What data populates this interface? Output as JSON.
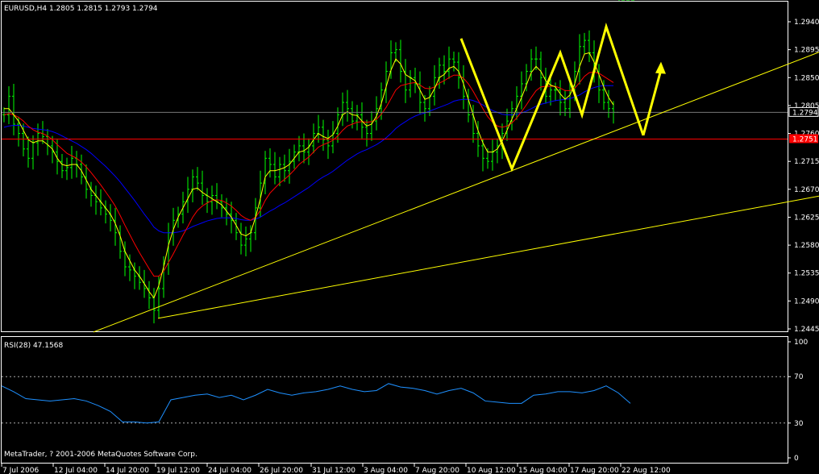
{
  "window": {
    "header_text": "EURUSD,H4  1.2805 1.2815 1.2793 1.2794",
    "copyright": "MetaTrader, ? 2001-2006 MetaQuotes Software Corp."
  },
  "colors": {
    "background": "#000000",
    "frame": "#ffffff",
    "bars": "#00ff00",
    "ma_fast": "#ffff00",
    "ma_medium": "#ff0000",
    "ma_slow": "#0000ff",
    "trendlines": "#ffff00",
    "support_line": "#ff0000",
    "pattern_overlay": "#ffff00",
    "rsi": "#1e90ff",
    "rsi_levels": "#aaaaaa"
  },
  "chart_data": [
    {
      "type": "candlestick",
      "symbol": "EURUSD",
      "timeframe": "H4",
      "ohlc_last": {
        "open": 1.2805,
        "high": 1.2815,
        "low": 1.2793,
        "close": 1.2794
      },
      "price_ticks": [
        "1.2940",
        "1.2895",
        "1.2850",
        "1.2805",
        "1.2760",
        "1.2715",
        "1.2670",
        "1.2625",
        "1.2580",
        "1.2535",
        "1.2490",
        "1.2445"
      ],
      "ylim": [
        1.244,
        1.2965
      ],
      "current_price_label": "1.2794",
      "support_price_label": "1.2751",
      "support_price": 1.2751,
      "time_ticks": [
        "7 Jul 2006",
        "12 Jul 04:00",
        "14 Jul 20:00",
        "19 Jul 12:00",
        "24 Jul 04:00",
        "26 Jul 20:00",
        "31 Jul 12:00",
        "3 Aug 04:00",
        "7 Aug 20:00",
        "10 Aug 12:00",
        "15 Aug 04:00",
        "17 Aug 20:00",
        "22 Aug 12:00"
      ],
      "price_series": {
        "x": [
          0,
          6,
          12,
          18,
          24,
          30,
          36,
          42,
          48,
          54,
          60,
          66,
          72,
          78,
          84,
          90,
          96,
          102,
          108,
          114,
          120,
          126,
          132,
          138,
          144,
          150,
          156,
          162,
          168,
          174,
          180,
          186,
          192,
          198,
          204,
          210,
          216,
          222,
          228,
          234,
          240,
          246,
          252,
          258,
          264,
          270,
          276,
          282,
          288,
          294,
          300,
          306,
          312,
          318,
          324,
          330,
          336,
          342,
          348,
          354,
          360,
          366,
          372,
          378,
          384,
          390,
          396,
          402,
          408,
          414,
          420,
          426,
          432,
          438,
          444,
          450,
          456,
          462,
          468,
          474,
          480,
          486,
          492,
          498,
          504,
          510,
          516,
          522,
          528,
          534,
          540,
          546,
          552,
          558,
          564,
          570,
          576,
          582,
          588,
          594,
          600,
          606,
          612,
          618,
          624,
          630,
          636,
          642,
          648,
          654,
          660,
          666,
          672,
          678,
          684,
          690,
          696,
          702,
          708,
          714,
          720,
          726,
          732,
          738,
          744,
          750,
          756,
          762,
          768,
          774,
          780
        ],
        "close": [
          1.279,
          1.282,
          1.2775,
          1.276,
          1.2735,
          1.272,
          1.2745,
          1.276,
          1.2755,
          1.274,
          1.273,
          1.2715,
          1.27,
          1.2705,
          1.272,
          1.271,
          1.269,
          1.267,
          1.266,
          1.265,
          1.264,
          1.263,
          1.262,
          1.26,
          1.257,
          1.2545,
          1.254,
          1.253,
          1.252,
          1.251,
          1.2495,
          1.2475,
          1.251,
          1.255,
          1.26,
          1.262,
          1.263,
          1.265,
          1.267,
          1.269,
          1.268,
          1.266,
          1.265,
          1.266,
          1.265,
          1.264,
          1.263,
          1.262,
          1.26,
          1.258,
          1.259,
          1.26,
          1.264,
          1.268,
          1.272,
          1.271,
          1.269,
          1.271,
          1.27,
          1.2715,
          1.273,
          1.274,
          1.273,
          1.274,
          1.276,
          1.277,
          1.275,
          1.274,
          1.276,
          1.279,
          1.281,
          1.28,
          1.278,
          1.279,
          1.277,
          1.276,
          1.278,
          1.28,
          1.283,
          1.286,
          1.289,
          1.2895,
          1.286,
          1.283,
          1.285,
          1.284,
          1.281,
          1.28,
          1.282,
          1.285,
          1.287,
          1.286,
          1.288,
          1.2875,
          1.285,
          1.282,
          1.279,
          1.276,
          1.274,
          1.272,
          1.2715,
          1.273,
          1.274,
          1.276,
          1.278,
          1.28,
          1.282,
          1.284,
          1.286,
          1.288,
          1.288,
          1.285,
          1.282,
          1.283,
          1.283,
          1.281,
          1.28,
          1.283,
          1.286,
          1.29,
          1.291,
          1.289,
          1.286,
          1.283,
          1.281,
          1.28,
          1.2794
        ],
        "ma_fast": [
          1.28,
          1.28,
          1.279,
          1.278,
          1.2765,
          1.275,
          1.2745,
          1.2748,
          1.2748,
          1.2742,
          1.2735,
          1.272,
          1.271,
          1.2708,
          1.271,
          1.271,
          1.27,
          1.2685,
          1.267,
          1.266,
          1.265,
          1.264,
          1.263,
          1.2615,
          1.2595,
          1.257,
          1.2555,
          1.254,
          1.253,
          1.2518,
          1.2505,
          1.2495,
          1.2515,
          1.2545,
          1.258,
          1.2605,
          1.2625,
          1.264,
          1.2655,
          1.267,
          1.2672,
          1.2665,
          1.266,
          1.2655,
          1.265,
          1.2645,
          1.2635,
          1.2625,
          1.2612,
          1.2598,
          1.2595,
          1.26,
          1.2625,
          1.2655,
          1.269,
          1.27,
          1.27,
          1.2702,
          1.2705,
          1.271,
          1.272,
          1.273,
          1.2732,
          1.2738,
          1.275,
          1.276,
          1.2755,
          1.2752,
          1.2758,
          1.2772,
          1.279,
          1.2795,
          1.279,
          1.2789,
          1.278,
          1.2772,
          1.2775,
          1.2788,
          1.2808,
          1.2835,
          1.2862,
          1.288,
          1.2872,
          1.2855,
          1.285,
          1.2845,
          1.283,
          1.2815,
          1.2818,
          1.2832,
          1.285,
          1.2855,
          1.2865,
          1.2868,
          1.286,
          1.284,
          1.2815,
          1.279,
          1.2765,
          1.2745,
          1.273,
          1.273,
          1.2735,
          1.2748,
          1.2765,
          1.2783,
          1.28,
          1.2818,
          1.2838,
          1.2858,
          1.2868,
          1.286,
          1.2845,
          1.2838,
          1.2835,
          1.2824,
          1.2815,
          1.2822,
          1.284,
          1.2868,
          1.2888,
          1.289,
          1.2875,
          1.2855,
          1.2835,
          1.2818,
          1.2806
        ],
        "ma_medium": [
          1.279,
          1.2792,
          1.279,
          1.2786,
          1.278,
          1.2772,
          1.2766,
          1.2762,
          1.276,
          1.2756,
          1.275,
          1.2742,
          1.2735,
          1.2728,
          1.2724,
          1.272,
          1.2714,
          1.2706,
          1.2697,
          1.2687,
          1.2677,
          1.2666,
          1.2655,
          1.2643,
          1.2628,
          1.2612,
          1.2597,
          1.2582,
          1.2568,
          1.2555,
          1.2542,
          1.253,
          1.253,
          1.2538,
          1.2552,
          1.2566,
          1.2581,
          1.2596,
          1.261,
          1.2625,
          1.2636,
          1.2643,
          1.2648,
          1.2652,
          1.2653,
          1.2652,
          1.2648,
          1.2643,
          1.2636,
          1.2628,
          1.2623,
          1.262,
          1.2625,
          1.2636,
          1.2652,
          1.2664,
          1.2672,
          1.268,
          1.2686,
          1.2693,
          1.2701,
          1.271,
          1.2716,
          1.2722,
          1.273,
          1.2738,
          1.2742,
          1.2745,
          1.2749,
          1.2756,
          1.2765,
          1.2772,
          1.2775,
          1.2778,
          1.2779,
          1.2778,
          1.2779,
          1.2783,
          1.2791,
          1.2802,
          1.2816,
          1.283,
          1.2837,
          1.2839,
          1.2841,
          1.2842,
          1.2838,
          1.2833,
          1.2832,
          1.2835,
          1.2841,
          1.2845,
          1.285,
          1.2854,
          1.2854,
          1.2849,
          1.284,
          1.2828,
          1.2814,
          1.28,
          1.2787,
          1.2778,
          1.2772,
          1.277,
          1.2772,
          1.2777,
          1.2785,
          1.2795,
          1.2806,
          1.2818,
          1.2829,
          1.2835,
          1.2836,
          1.2836,
          1.2836,
          1.2833,
          1.2829,
          1.2829,
          1.2833,
          1.2842,
          1.2852,
          1.2858,
          1.2859,
          1.2857,
          1.2852,
          1.2847,
          1.2842
        ],
        "ma_slow": [
          1.277,
          1.2772,
          1.2773,
          1.2773,
          1.2772,
          1.277,
          1.2768,
          1.2767,
          1.2766,
          1.2765,
          1.2763,
          1.276,
          1.2756,
          1.2752,
          1.2748,
          1.2744,
          1.2739,
          1.2734,
          1.2728,
          1.2721,
          1.2714,
          1.2707,
          1.2699,
          1.2691,
          1.2682,
          1.2672,
          1.2662,
          1.2652,
          1.2641,
          1.263,
          1.262,
          1.2609,
          1.2603,
          1.26,
          1.26,
          1.26,
          1.2601,
          1.2603,
          1.2606,
          1.261,
          1.2613,
          1.2616,
          1.2619,
          1.2621,
          1.2623,
          1.2624,
          1.2624,
          1.2624,
          1.2623,
          1.2621,
          1.262,
          1.262,
          1.2622,
          1.2625,
          1.263,
          1.2635,
          1.2639,
          1.2644,
          1.2648,
          1.2653,
          1.2658,
          1.2663,
          1.2668,
          1.2673,
          1.2679,
          1.2685,
          1.269,
          1.2694,
          1.2699,
          1.2705,
          1.2711,
          1.2717,
          1.2722,
          1.2727,
          1.2731,
          1.2734,
          1.2738,
          1.2742,
          1.2747,
          1.2753,
          1.276,
          1.2768,
          1.2774,
          1.2779,
          1.2784,
          1.2788,
          1.2791,
          1.2793,
          1.2796,
          1.2799,
          1.2802,
          1.2805,
          1.2808,
          1.2812,
          1.2814,
          1.2815,
          1.2815,
          1.2813,
          1.281,
          1.2806,
          1.2801,
          1.2797,
          1.2794,
          1.2791,
          1.279,
          1.279,
          1.2791,
          1.2793,
          1.2796,
          1.28,
          1.2804,
          1.2807,
          1.2809,
          1.2811,
          1.2813,
          1.2814,
          1.2815,
          1.2816,
          1.2819,
          1.2822,
          1.2827,
          1.2831,
          1.2834,
          1.2836,
          1.2837,
          1.2837,
          1.2837
        ]
      },
      "trendlines": [
        {
          "x": [
            116,
            1016
          ],
          "y": [
            1.244,
            1.2891
          ]
        },
        {
          "x": [
            196,
            1016
          ],
          "y": [
            1.2462,
            1.2659
          ]
        }
      ],
      "pattern_overlay": {
        "x": [
          572,
          635,
          695,
          722,
          752,
          798
        ],
        "y": [
          1.2913,
          1.2703,
          1.289,
          1.279,
          1.2932,
          1.2757
        ],
        "arrow_to": {
          "x": 820,
          "y": 1.2873
        }
      }
    },
    {
      "type": "line",
      "title": "RSI(28) 47.1568",
      "ticks": [
        "100",
        "70",
        "30",
        "0"
      ],
      "levels": [
        70,
        30
      ],
      "ylim": [
        0,
        100
      ],
      "x": [
        0,
        15,
        30,
        45,
        60,
        75,
        90,
        105,
        120,
        135,
        150,
        165,
        180,
        195,
        210,
        225,
        240,
        255,
        270,
        285,
        300,
        315,
        330,
        345,
        360,
        375,
        390,
        405,
        420,
        435,
        450,
        465,
        480,
        495,
        510,
        525,
        540,
        555,
        570,
        585,
        600,
        615,
        630,
        645,
        660,
        675,
        690,
        705,
        720,
        735,
        750,
        765,
        780
      ],
      "values": [
        62,
        57,
        51,
        50,
        49,
        50,
        51,
        49,
        45,
        40,
        31,
        31,
        30,
        31,
        50,
        52,
        54,
        55,
        52,
        54,
        50,
        54,
        59,
        56,
        54,
        56,
        57,
        59,
        62,
        59,
        57,
        58,
        64,
        61,
        60,
        58,
        55,
        58,
        60,
        56,
        49,
        48,
        47,
        47,
        54,
        55,
        57,
        57,
        56,
        58,
        62,
        56,
        47
      ]
    }
  ]
}
